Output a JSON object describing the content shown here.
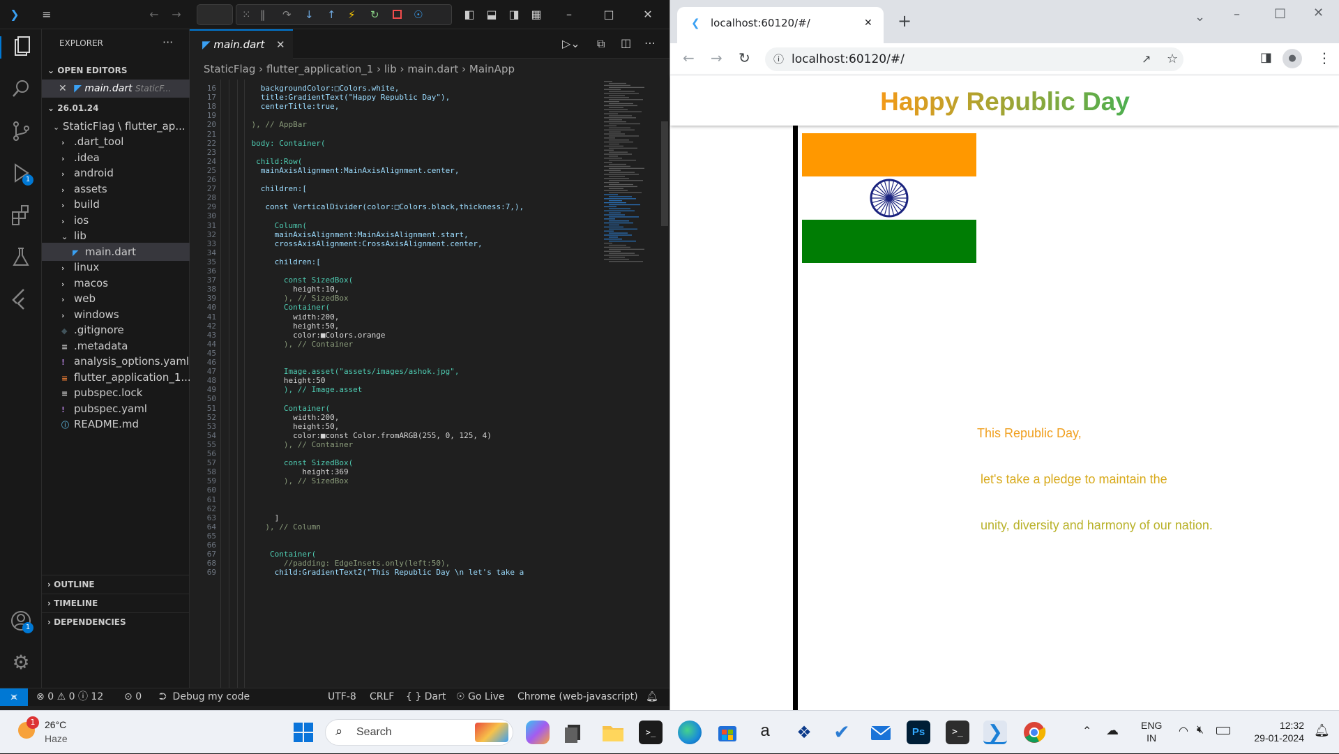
{
  "vscode": {
    "sidebar": {
      "title": "EXPLORER",
      "more": "···",
      "open_editors_label": "OPEN EDITORS",
      "open_editor_file": "main.dart",
      "open_editor_path": "StaticF...",
      "folder_label": "26.01.24",
      "project_label": "StaticFlag \\ flutter_ap...",
      "items": [
        {
          "label": ".dart_tool",
          "kind": "folder"
        },
        {
          "label": ".idea",
          "kind": "folder"
        },
        {
          "label": "android",
          "kind": "folder"
        },
        {
          "label": "assets",
          "kind": "folder"
        },
        {
          "label": "build",
          "kind": "folder"
        },
        {
          "label": "ios",
          "kind": "folder"
        },
        {
          "label": "lib",
          "kind": "folder-open"
        },
        {
          "label": "main.dart",
          "kind": "dart-file"
        },
        {
          "label": "linux",
          "kind": "folder"
        },
        {
          "label": "macos",
          "kind": "folder"
        },
        {
          "label": "web",
          "kind": "folder"
        },
        {
          "label": "windows",
          "kind": "folder"
        },
        {
          "label": ".gitignore",
          "kind": "git-file"
        },
        {
          "label": ".metadata",
          "kind": "text-file"
        },
        {
          "label": "analysis_options.yaml",
          "kind": "yaml-file"
        },
        {
          "label": "flutter_application_1...",
          "kind": "rss-file"
        },
        {
          "label": "pubspec.lock",
          "kind": "text-file"
        },
        {
          "label": "pubspec.yaml",
          "kind": "yaml-file"
        },
        {
          "label": "README.md",
          "kind": "info-file"
        }
      ],
      "outline_label": "OUTLINE",
      "timeline_label": "TIMELINE",
      "dependencies_label": "DEPENDENCIES"
    },
    "activity_badges": {
      "run": "1",
      "accounts": "1"
    },
    "tab_label": "main.dart",
    "breadcrumb": [
      "StaticFlag",
      "flutter_application_1",
      "lib",
      "main.dart",
      "MainApp"
    ],
    "code_lines": [
      {
        "n": "16",
        "t": "      backgroundColor:□Colors.white,"
      },
      {
        "n": "17",
        "t": "      title:GradientText(\"Happy Republic Day\"),"
      },
      {
        "n": "18",
        "t": "      centerTitle:true,"
      },
      {
        "n": "19",
        "t": ""
      },
      {
        "n": "20",
        "t": "    ), // AppBar"
      },
      {
        "n": "21",
        "t": ""
      },
      {
        "n": "22",
        "t": "    body: Container("
      },
      {
        "n": "23",
        "t": ""
      },
      {
        "n": "24",
        "t": "     child:Row("
      },
      {
        "n": "25",
        "t": "      mainAxisAlignment:MainAxisAlignment.center,"
      },
      {
        "n": "26",
        "t": ""
      },
      {
        "n": "27",
        "t": "      children:["
      },
      {
        "n": "28",
        "t": ""
      },
      {
        "n": "29",
        "t": "       const VerticalDivider(color:□Colors.black,thickness:7,),"
      },
      {
        "n": "30",
        "t": ""
      },
      {
        "n": "31",
        "t": "         Column("
      },
      {
        "n": "32",
        "t": "         mainAxisAlignment:MainAxisAlignment.start,"
      },
      {
        "n": "33",
        "t": "         crossAxisAlignment:CrossAxisAlignment.center,"
      },
      {
        "n": "34",
        "t": ""
      },
      {
        "n": "35",
        "t": "         children:["
      },
      {
        "n": "36",
        "t": ""
      },
      {
        "n": "37",
        "t": "           const SizedBox("
      },
      {
        "n": "38",
        "t": "             height:10,"
      },
      {
        "n": "39",
        "t": "           ), // SizedBox"
      },
      {
        "n": "40",
        "t": "           Container("
      },
      {
        "n": "41",
        "t": "             width:200,"
      },
      {
        "n": "42",
        "t": "             height:50,"
      },
      {
        "n": "43",
        "t": "             color:■Colors.orange"
      },
      {
        "n": "44",
        "t": "           ), // Container"
      },
      {
        "n": "45",
        "t": ""
      },
      {
        "n": "46",
        "t": ""
      },
      {
        "n": "47",
        "t": "           Image.asset(\"assets/images/ashok.jpg\","
      },
      {
        "n": "48",
        "t": "           height:50"
      },
      {
        "n": "49",
        "t": "           ), // Image.asset"
      },
      {
        "n": "50",
        "t": ""
      },
      {
        "n": "51",
        "t": "           Container("
      },
      {
        "n": "52",
        "t": "             width:200,"
      },
      {
        "n": "53",
        "t": "             height:50,"
      },
      {
        "n": "54",
        "t": "             color:■const Color.fromARGB(255, 0, 125, 4)"
      },
      {
        "n": "55",
        "t": "           ), // Container"
      },
      {
        "n": "56",
        "t": ""
      },
      {
        "n": "57",
        "t": "           const SizedBox("
      },
      {
        "n": "58",
        "t": "               height:369"
      },
      {
        "n": "59",
        "t": "           ), // SizedBox"
      },
      {
        "n": "60",
        "t": ""
      },
      {
        "n": "61",
        "t": ""
      },
      {
        "n": "62",
        "t": ""
      },
      {
        "n": "63",
        "t": "         ]"
      },
      {
        "n": "64",
        "t": "       ), // Column"
      },
      {
        "n": "65",
        "t": ""
      },
      {
        "n": "66",
        "t": ""
      },
      {
        "n": "67",
        "t": "        Container("
      },
      {
        "n": "68",
        "t": "           //padding: EdgeInsets.only(left:50),"
      },
      {
        "n": "69",
        "t": "         child:GradientText2(\"This Republic Day \\n let's take a"
      }
    ],
    "status": {
      "errors": "0",
      "warnings": "0",
      "info": "12",
      "ports": "0",
      "debug": "Debug my code",
      "encoding": "UTF-8",
      "eol": "CRLF",
      "language": "{ } Dart",
      "golive": "Go Live",
      "device": "Chrome (web-javascript)"
    }
  },
  "chrome": {
    "tab_title": "localhost:60120/#/",
    "url": "localhost:60120/#/",
    "app_title": "Happy Republic Day",
    "message": [
      "This Republic Day,",
      " let's take a pledge to maintain the",
      " unity, diversity and harmony of our nation."
    ],
    "colors": {
      "saffron": "#ff9800",
      "white": "#ffffff",
      "green": "#007d04",
      "chakra": "#1a237e",
      "title_from": "#f39a19",
      "title_to": "#4caf50"
    }
  },
  "taskbar": {
    "weather_temp": "26°C",
    "weather_desc": "Haze",
    "weather_badge": "1",
    "search": "Search",
    "lang1": "ENG",
    "lang2": "IN",
    "time": "12:32",
    "date": "29-01-2024"
  }
}
